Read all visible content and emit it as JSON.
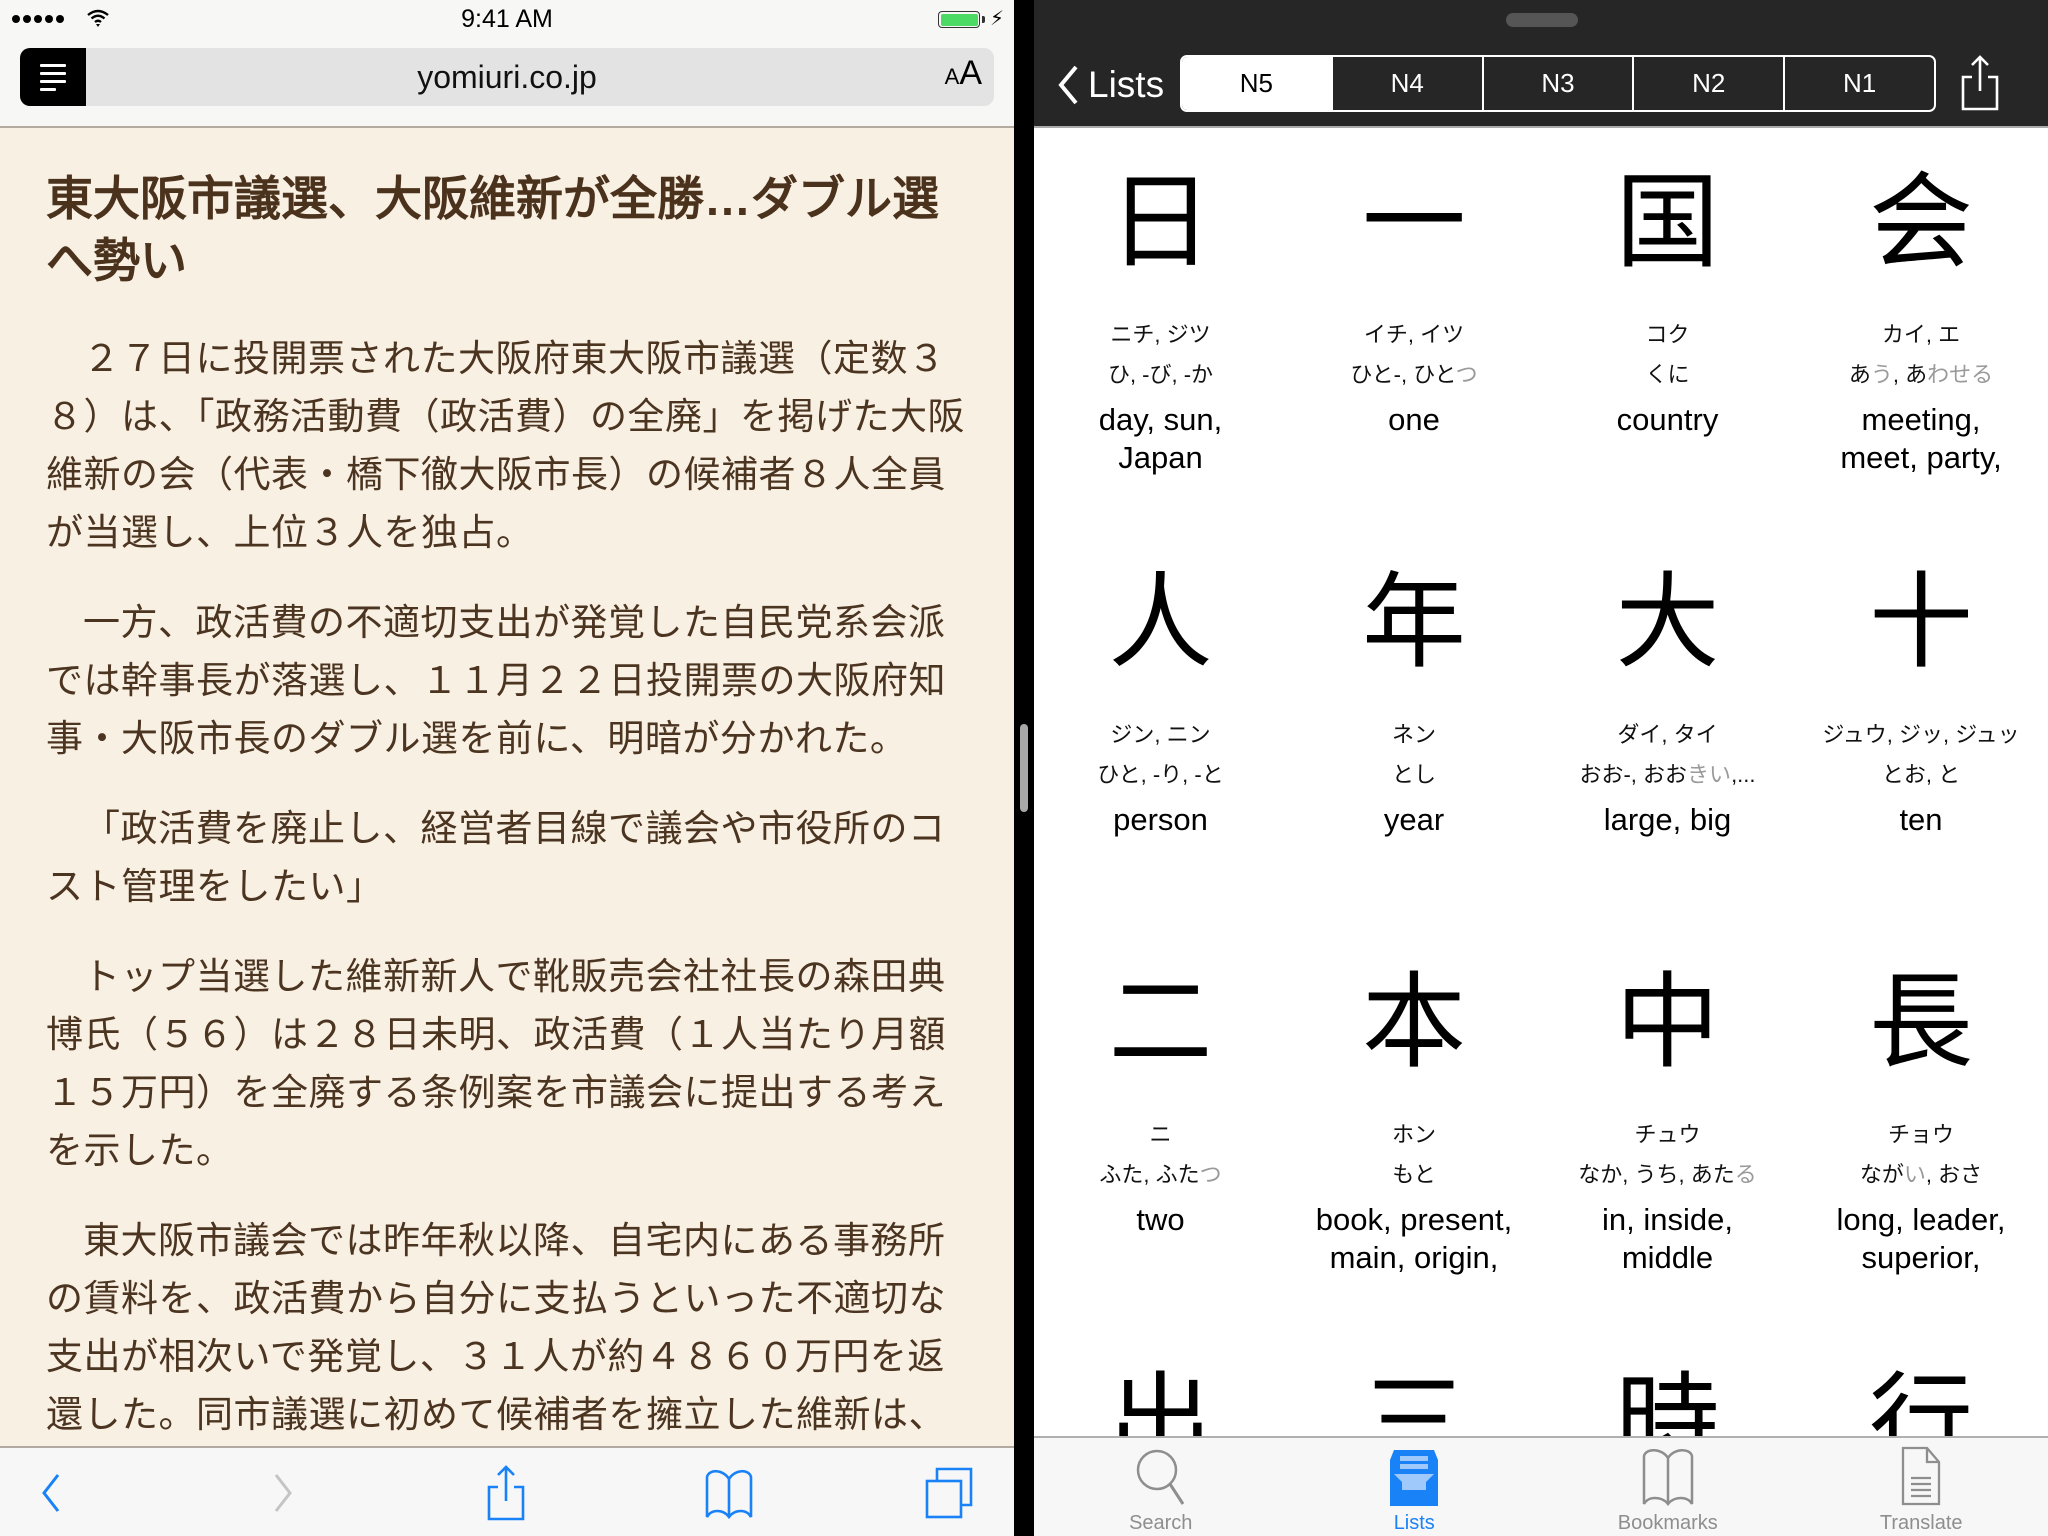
{
  "status_bar": {
    "time": "9:41 AM",
    "signal_bars": 5,
    "battery_level": 1.0,
    "charging": true,
    "battery_color": "#4cd964"
  },
  "safari": {
    "url": "yomiuri.co.jp",
    "text_size_label_small": "A",
    "text_size_label_large": "A",
    "reader_icon": "reader-list-icon",
    "accent_color": "#1a82f7",
    "toolbar": {
      "back_icon": "chevron-left-icon",
      "forward_icon": "chevron-right-icon",
      "share_icon": "share-icon",
      "bookmarks_icon": "book-icon",
      "tabs_icon": "tabs-icon",
      "forward_enabled": false
    }
  },
  "article": {
    "headline": "東大阪市議選、大阪維新が全勝…ダブル選へ勢い",
    "paragraphs": [
      "２７日に投開票された大阪府東大阪市議選（定数３８）は、「政務活動費（政活費）の全廃」を掲げた大阪維新の会（代表・橋下徹大阪市長）の候補者８人全員が当選し、上位３人を独占。",
      "一方、政活費の不適切支出が発覚した自民党系会派では幹事長が落選し、１１月２２日投開票の大阪府知事・大阪市長のダブル選を前に、明暗が分かれた。",
      "「政活費を廃止し、経営者目線で議会や市役所のコスト管理をしたい」",
      "トップ当選した維新新人で靴販売会社社長の森田典博氏（５６）は２８日未明、政活費（１人当たり月額１５万円）を全廃する条例案を市議会に提出する考えを示した。",
      "東大阪市議会では昨年秋以降、自宅内にある事務所の賃料を、政活費から自分に支払うといった不適切な支出が相次いで発覚し、３１人が約４８６０万円を返還した。同市議選に初めて候補者を擁立した維新は、政活費"
    ]
  },
  "kanji_app": {
    "back_label": "Lists",
    "segments": [
      "N5",
      "N4",
      "N3",
      "N2",
      "N1"
    ],
    "selected_segment": "N5",
    "share_icon": "share-icon",
    "kanji": [
      {
        "char": "日",
        "on": "ニチ, ジツ",
        "kun": [
          {
            "t": "ひ, -び, -か",
            "g": ""
          }
        ],
        "meaning": "day, sun, Japan"
      },
      {
        "char": "一",
        "on": "イチ, イツ",
        "kun": [
          {
            "t": "ひと-, ひと",
            "g": "つ"
          }
        ],
        "meaning": "one"
      },
      {
        "char": "国",
        "on": "コク",
        "kun": [
          {
            "t": "くに",
            "g": ""
          }
        ],
        "meaning": "country"
      },
      {
        "char": "会",
        "on": "カイ, エ",
        "kun": [
          {
            "t": "あ",
            "g": "う"
          },
          {
            "t": ", あ",
            "g": "わせる"
          }
        ],
        "meaning": "meeting, meet, party,"
      },
      {
        "char": "人",
        "on": "ジン, ニン",
        "kun": [
          {
            "t": "ひと, -り, -と",
            "g": ""
          }
        ],
        "meaning": "person"
      },
      {
        "char": "年",
        "on": "ネン",
        "kun": [
          {
            "t": "とし",
            "g": ""
          }
        ],
        "meaning": "year"
      },
      {
        "char": "大",
        "on": "ダイ, タイ",
        "kun": [
          {
            "t": "おお-, おお",
            "g": "きい"
          },
          {
            "t": ",...",
            "g": ""
          }
        ],
        "meaning": "large, big"
      },
      {
        "char": "十",
        "on": "ジュウ, ジッ, ジュッ",
        "kun": [
          {
            "t": "とお, と",
            "g": ""
          }
        ],
        "meaning": "ten"
      },
      {
        "char": "二",
        "on": "ニ",
        "kun": [
          {
            "t": "ふた, ふた",
            "g": "つ"
          }
        ],
        "meaning": "two"
      },
      {
        "char": "本",
        "on": "ホン",
        "kun": [
          {
            "t": "もと",
            "g": ""
          }
        ],
        "meaning": "book, present, main, origin,"
      },
      {
        "char": "中",
        "on": "チュウ",
        "kun": [
          {
            "t": "なか, うち, あた",
            "g": "る"
          }
        ],
        "meaning": "in, inside, middle"
      },
      {
        "char": "長",
        "on": "チョウ",
        "kun": [
          {
            "t": "なが",
            "g": "い"
          },
          {
            "t": ", おさ",
            "g": ""
          }
        ],
        "meaning": "long, leader, superior,"
      },
      {
        "char": "出",
        "on": "",
        "kun": [],
        "meaning": ""
      },
      {
        "char": "三",
        "on": "",
        "kun": [],
        "meaning": ""
      },
      {
        "char": "時",
        "on": "",
        "kun": [],
        "meaning": ""
      },
      {
        "char": "行",
        "on": "",
        "kun": [],
        "meaning": ""
      }
    ],
    "tabs": [
      {
        "label": "Search",
        "icon": "search-icon",
        "active": false
      },
      {
        "label": "Lists",
        "icon": "lists-icon",
        "active": true
      },
      {
        "label": "Bookmarks",
        "icon": "bookmarks-icon",
        "active": false
      },
      {
        "label": "Translate",
        "icon": "translate-icon",
        "active": false
      }
    ],
    "accent_color": "#1a82f7"
  }
}
